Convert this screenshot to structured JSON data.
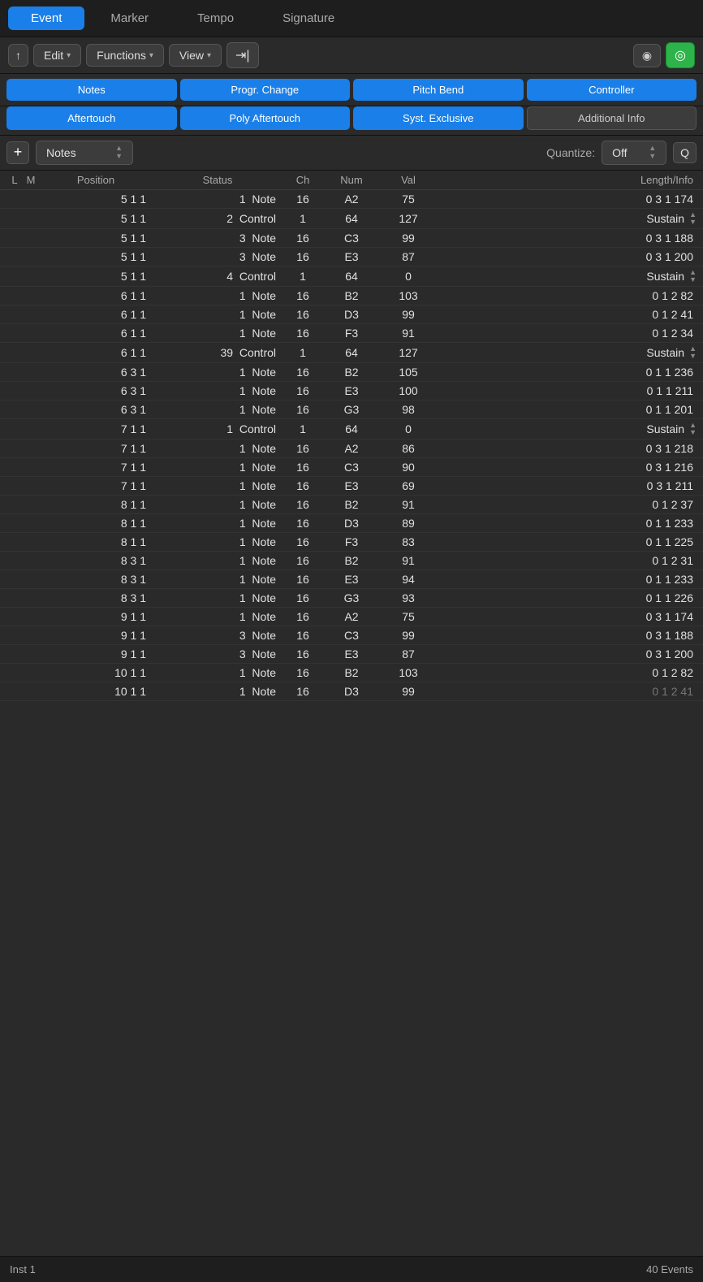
{
  "tabs": [
    {
      "label": "Event",
      "active": true
    },
    {
      "label": "Marker",
      "active": false
    },
    {
      "label": "Tempo",
      "active": false
    },
    {
      "label": "Signature",
      "active": false
    }
  ],
  "toolbar": {
    "up_icon": "↑",
    "edit_label": "Edit",
    "functions_label": "Functions",
    "view_label": "View",
    "midi_icon": "⇥",
    "face_icon": "◉",
    "green_icon": "◎"
  },
  "filter_row1": [
    {
      "label": "Notes",
      "active": true
    },
    {
      "label": "Progr. Change",
      "active": true
    },
    {
      "label": "Pitch Bend",
      "active": true
    },
    {
      "label": "Controller",
      "active": true
    }
  ],
  "filter_row2": [
    {
      "label": "Aftertouch",
      "active": true
    },
    {
      "label": "Poly Aftertouch",
      "active": true
    },
    {
      "label": "Syst. Exclusive",
      "active": true
    },
    {
      "label": "Additional Info",
      "active": false
    }
  ],
  "event_type": {
    "add_label": "+",
    "type_label": "Notes",
    "quantize_label": "Quantize:",
    "quantize_value": "Off",
    "q_label": "Q"
  },
  "table_headers": {
    "l": "L",
    "m": "M",
    "position": "Position",
    "status": "Status",
    "ch": "Ch",
    "num": "Num",
    "val": "Val",
    "length_info": "Length/Info"
  },
  "rows": [
    {
      "pos": "5  1  1",
      "num1": "1",
      "status": "Note",
      "ch": "16",
      "note": "A2",
      "val": "75",
      "length": "0  3  1  174",
      "sustain": false
    },
    {
      "pos": "5  1  1",
      "num1": "2",
      "status": "Control",
      "ch": "1",
      "note": "64",
      "val": "127",
      "length": "Sustain",
      "sustain": true
    },
    {
      "pos": "5  1  1",
      "num1": "3",
      "status": "Note",
      "ch": "16",
      "note": "C3",
      "val": "99",
      "length": "0  3  1  188",
      "sustain": false
    },
    {
      "pos": "5  1  1",
      "num1": "3",
      "status": "Note",
      "ch": "16",
      "note": "E3",
      "val": "87",
      "length": "0  3  1  200",
      "sustain": false
    },
    {
      "pos": "5  1  1",
      "num1": "4",
      "status": "Control",
      "ch": "1",
      "note": "64",
      "val": "0",
      "length": "Sustain",
      "sustain": true
    },
    {
      "pos": "6  1  1",
      "num1": "1",
      "status": "Note",
      "ch": "16",
      "note": "B2",
      "val": "103",
      "length": "0  1  2  82",
      "sustain": false
    },
    {
      "pos": "6  1  1",
      "num1": "1",
      "status": "Note",
      "ch": "16",
      "note": "D3",
      "val": "99",
      "length": "0  1  2  41",
      "sustain": false
    },
    {
      "pos": "6  1  1",
      "num1": "1",
      "status": "Note",
      "ch": "16",
      "note": "F3",
      "val": "91",
      "length": "0  1  2  34",
      "sustain": false
    },
    {
      "pos": "6  1  1",
      "num1": "39",
      "status": "Control",
      "ch": "1",
      "note": "64",
      "val": "127",
      "length": "Sustain",
      "sustain": true
    },
    {
      "pos": "6  3  1",
      "num1": "1",
      "status": "Note",
      "ch": "16",
      "note": "B2",
      "val": "105",
      "length": "0  1  1  236",
      "sustain": false
    },
    {
      "pos": "6  3  1",
      "num1": "1",
      "status": "Note",
      "ch": "16",
      "note": "E3",
      "val": "100",
      "length": "0  1  1  211",
      "sustain": false
    },
    {
      "pos": "6  3  1",
      "num1": "1",
      "status": "Note",
      "ch": "16",
      "note": "G3",
      "val": "98",
      "length": "0  1  1  201",
      "sustain": false
    },
    {
      "pos": "7  1  1",
      "num1": "1",
      "status": "Control",
      "ch": "1",
      "note": "64",
      "val": "0",
      "length": "Sustain",
      "sustain": true
    },
    {
      "pos": "7  1  1",
      "num1": "1",
      "status": "Note",
      "ch": "16",
      "note": "A2",
      "val": "86",
      "length": "0  3  1  218",
      "sustain": false
    },
    {
      "pos": "7  1  1",
      "num1": "1",
      "status": "Note",
      "ch": "16",
      "note": "C3",
      "val": "90",
      "length": "0  3  1  216",
      "sustain": false
    },
    {
      "pos": "7  1  1",
      "num1": "1",
      "status": "Note",
      "ch": "16",
      "note": "E3",
      "val": "69",
      "length": "0  3  1  211",
      "sustain": false
    },
    {
      "pos": "8  1  1",
      "num1": "1",
      "status": "Note",
      "ch": "16",
      "note": "B2",
      "val": "91",
      "length": "0  1  2  37",
      "sustain": false
    },
    {
      "pos": "8  1  1",
      "num1": "1",
      "status": "Note",
      "ch": "16",
      "note": "D3",
      "val": "89",
      "length": "0  1  1  233",
      "sustain": false
    },
    {
      "pos": "8  1  1",
      "num1": "1",
      "status": "Note",
      "ch": "16",
      "note": "F3",
      "val": "83",
      "length": "0  1  1  225",
      "sustain": false
    },
    {
      "pos": "8  3  1",
      "num1": "1",
      "status": "Note",
      "ch": "16",
      "note": "B2",
      "val": "91",
      "length": "0  1  2  31",
      "sustain": false
    },
    {
      "pos": "8  3  1",
      "num1": "1",
      "status": "Note",
      "ch": "16",
      "note": "E3",
      "val": "94",
      "length": "0  1  1  233",
      "sustain": false
    },
    {
      "pos": "8  3  1",
      "num1": "1",
      "status": "Note",
      "ch": "16",
      "note": "G3",
      "val": "93",
      "length": "0  1  1  226",
      "sustain": false
    },
    {
      "pos": "9  1  1",
      "num1": "1",
      "status": "Note",
      "ch": "16",
      "note": "A2",
      "val": "75",
      "length": "0  3  1  174",
      "sustain": false
    },
    {
      "pos": "9  1  1",
      "num1": "3",
      "status": "Note",
      "ch": "16",
      "note": "C3",
      "val": "99",
      "length": "0  3  1  188",
      "sustain": false
    },
    {
      "pos": "9  1  1",
      "num1": "3",
      "status": "Note",
      "ch": "16",
      "note": "E3",
      "val": "87",
      "length": "0  3  1  200",
      "sustain": false
    },
    {
      "pos": "10  1  1",
      "num1": "1",
      "status": "Note",
      "ch": "16",
      "note": "B2",
      "val": "103",
      "length": "0  1  2  82",
      "sustain": false
    },
    {
      "pos": "10  1  1",
      "num1": "1",
      "status": "Note",
      "ch": "16",
      "note": "D3",
      "val": "99",
      "length": "0  1  2  41",
      "sustain": false,
      "partial": true
    }
  ],
  "status_bar": {
    "inst": "Inst 1",
    "events": "40 Events"
  }
}
